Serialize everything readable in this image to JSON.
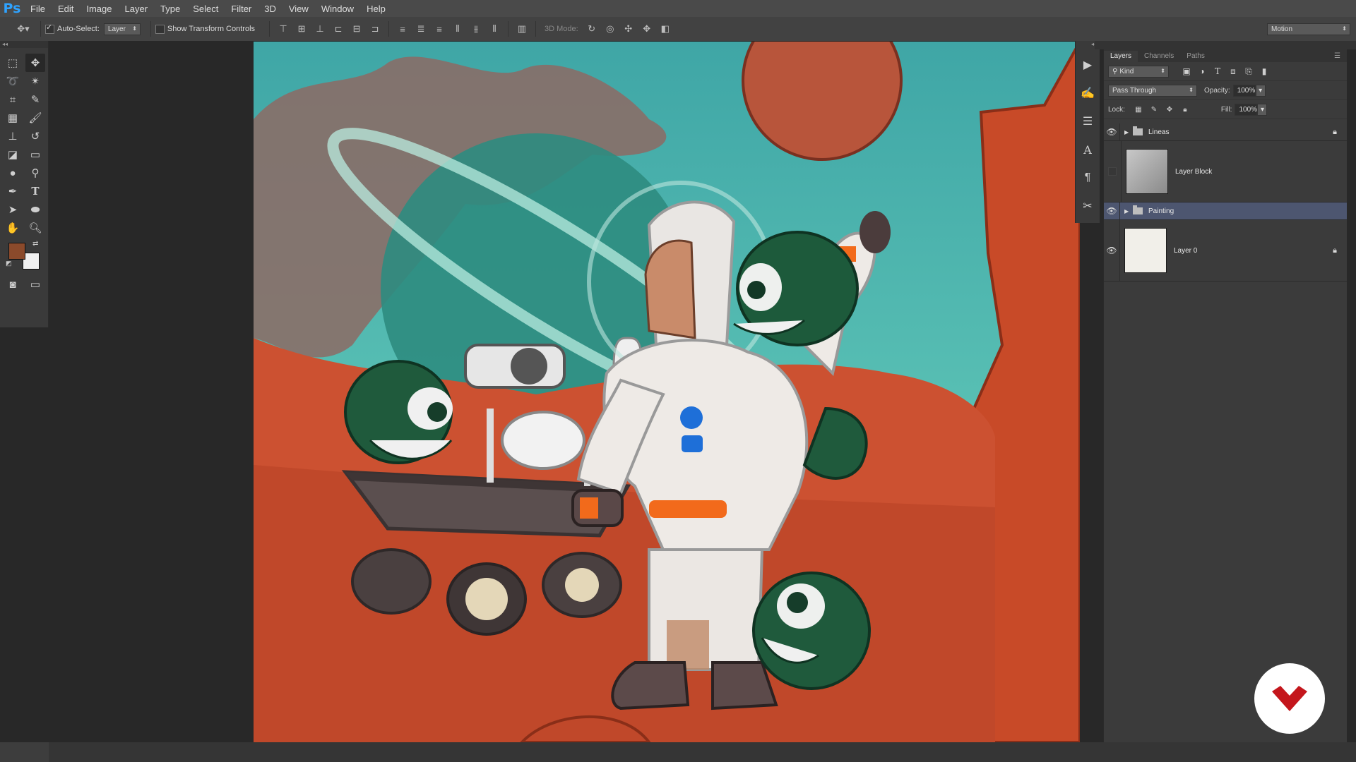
{
  "app": {
    "logo": "Ps"
  },
  "menu": [
    "File",
    "Edit",
    "Image",
    "Layer",
    "Type",
    "Select",
    "Filter",
    "3D",
    "View",
    "Window",
    "Help"
  ],
  "options": {
    "auto_select_label": "Auto-Select:",
    "auto_select_value": "Layer",
    "show_transform_label": "Show Transform Controls",
    "mode_3d_label": "3D Mode:",
    "workspace": "Motion"
  },
  "layers_panel": {
    "tabs": [
      "Layers",
      "Channels",
      "Paths"
    ],
    "kind_filter": "Kind",
    "blend_mode": "Pass Through",
    "opacity_label": "Opacity:",
    "opacity_value": "100%",
    "lock_label": "Lock:",
    "fill_label": "Fill:",
    "fill_value": "100%",
    "layers": [
      {
        "name": "Lineas",
        "type": "group",
        "visible": true,
        "locked": true
      },
      {
        "name": "Layer Block",
        "type": "layer",
        "visible": false,
        "locked": false
      },
      {
        "name": "Painting",
        "type": "group",
        "visible": true,
        "locked": false,
        "selected": true
      },
      {
        "name": "Layer 0",
        "type": "layer",
        "visible": true,
        "locked": true
      }
    ]
  },
  "colors": {
    "foreground": "#8b4a2b",
    "background": "#f0f0f0",
    "selection": "#4d5670",
    "brand": "#c4161c"
  }
}
